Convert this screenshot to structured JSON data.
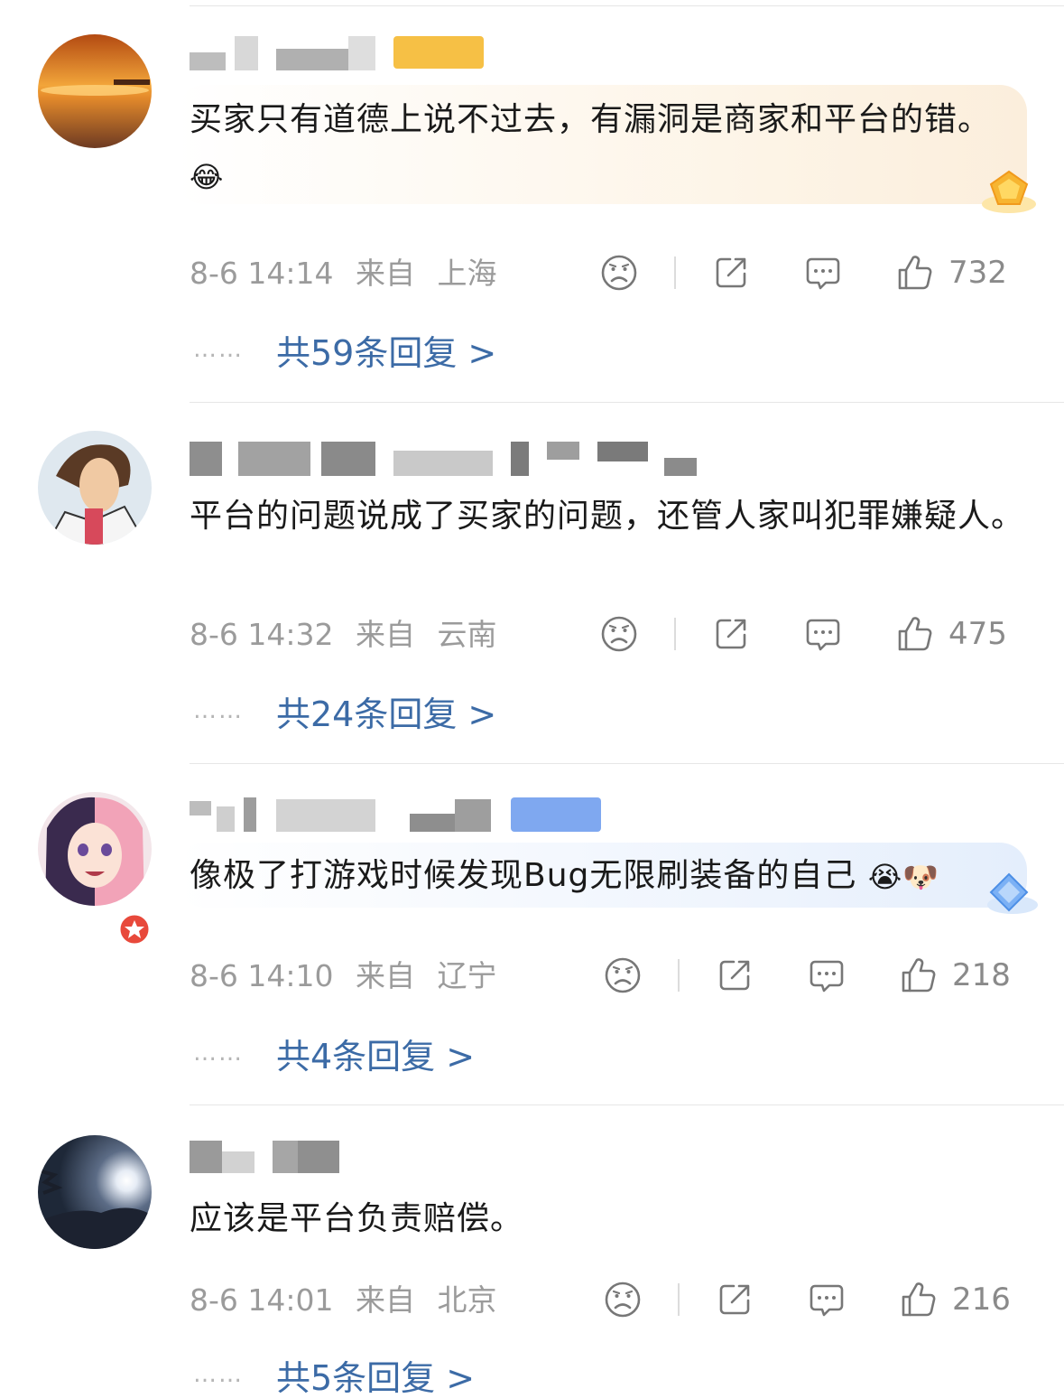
{
  "comments": [
    {
      "text": "买家只有道德上说不过去，有漏洞是商家和平台的错。",
      "emoji": "😂",
      "time": "8-6 14:14",
      "from_label": "来自",
      "location": "上海",
      "likes": "732",
      "replies": "共59条回复 >"
    },
    {
      "text": "平台的问题说成了买家的问题，还管人家叫犯罪嫌疑人。",
      "emoji": "",
      "time": "8-6 14:32",
      "from_label": "来自",
      "location": "云南",
      "likes": "475",
      "replies": "共24条回复 >"
    },
    {
      "text": "像极了打游戏时候发现Bug无限刷装备的自己",
      "emoji": "😭🐶",
      "time": "8-6 14:10",
      "from_label": "来自",
      "location": "辽宁",
      "likes": "218",
      "replies": "共4条回复 >"
    },
    {
      "text": "应该是平台负责赔偿。",
      "emoji": "",
      "time": "8-6 14:01",
      "from_label": "来自",
      "location": "北京",
      "likes": "216",
      "replies": "共5条回复 >"
    }
  ],
  "icons": {
    "dislike": "frown-face-icon",
    "share": "share-icon",
    "comment": "comment-bubble-icon",
    "like": "thumbs-up-icon"
  },
  "colors": {
    "reply_link": "#3c6ba6",
    "meta_text": "#9b9b9b"
  }
}
